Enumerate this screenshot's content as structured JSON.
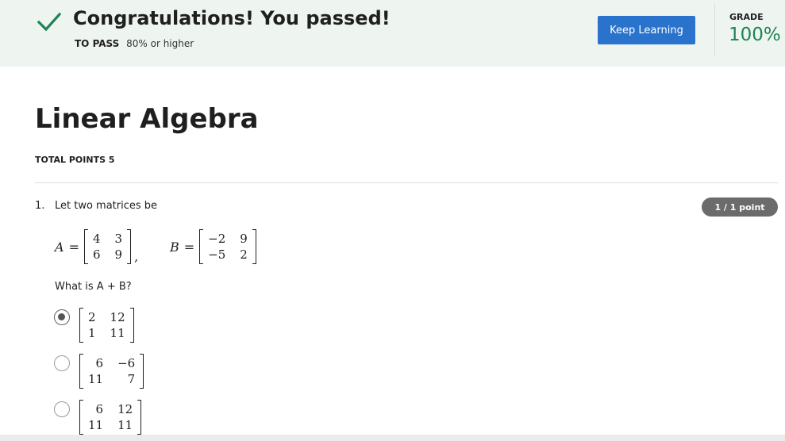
{
  "banner": {
    "title": "Congratulations! You passed!",
    "pass_label": "TO PASS",
    "pass_value": "80% or higher",
    "keep_learning_label": "Keep Learning",
    "grade_label": "GRADE",
    "grade_value": "100%",
    "check_icon": "check-icon",
    "colors": {
      "background": "#eef5f1",
      "check": "#1f8355",
      "button": "#2a73cc",
      "grade": "#1f8355"
    }
  },
  "quiz": {
    "title": "Linear Algebra",
    "total_points": "TOTAL POINTS 5"
  },
  "question": {
    "number": "1.",
    "prompt": "Let two matrices be",
    "points_badge": "1 / 1 point",
    "matrix_a_label": "A",
    "matrix_b_label": "B",
    "equals": "=",
    "comma": ",",
    "matrix_a": [
      [
        "4",
        "3"
      ],
      [
        "6",
        "9"
      ]
    ],
    "matrix_b": [
      [
        "−2",
        "9"
      ],
      [
        "−5",
        "2"
      ]
    ],
    "ask": "What is A + B?",
    "options": [
      {
        "matrix": [
          [
            "2",
            "12"
          ],
          [
            "1",
            "11"
          ]
        ],
        "selected": true
      },
      {
        "matrix": [
          [
            "6",
            "−6"
          ],
          [
            "11",
            "7"
          ]
        ],
        "selected": false
      },
      {
        "matrix": [
          [
            "6",
            "12"
          ],
          [
            "11",
            "11"
          ]
        ],
        "selected": false
      }
    ]
  }
}
